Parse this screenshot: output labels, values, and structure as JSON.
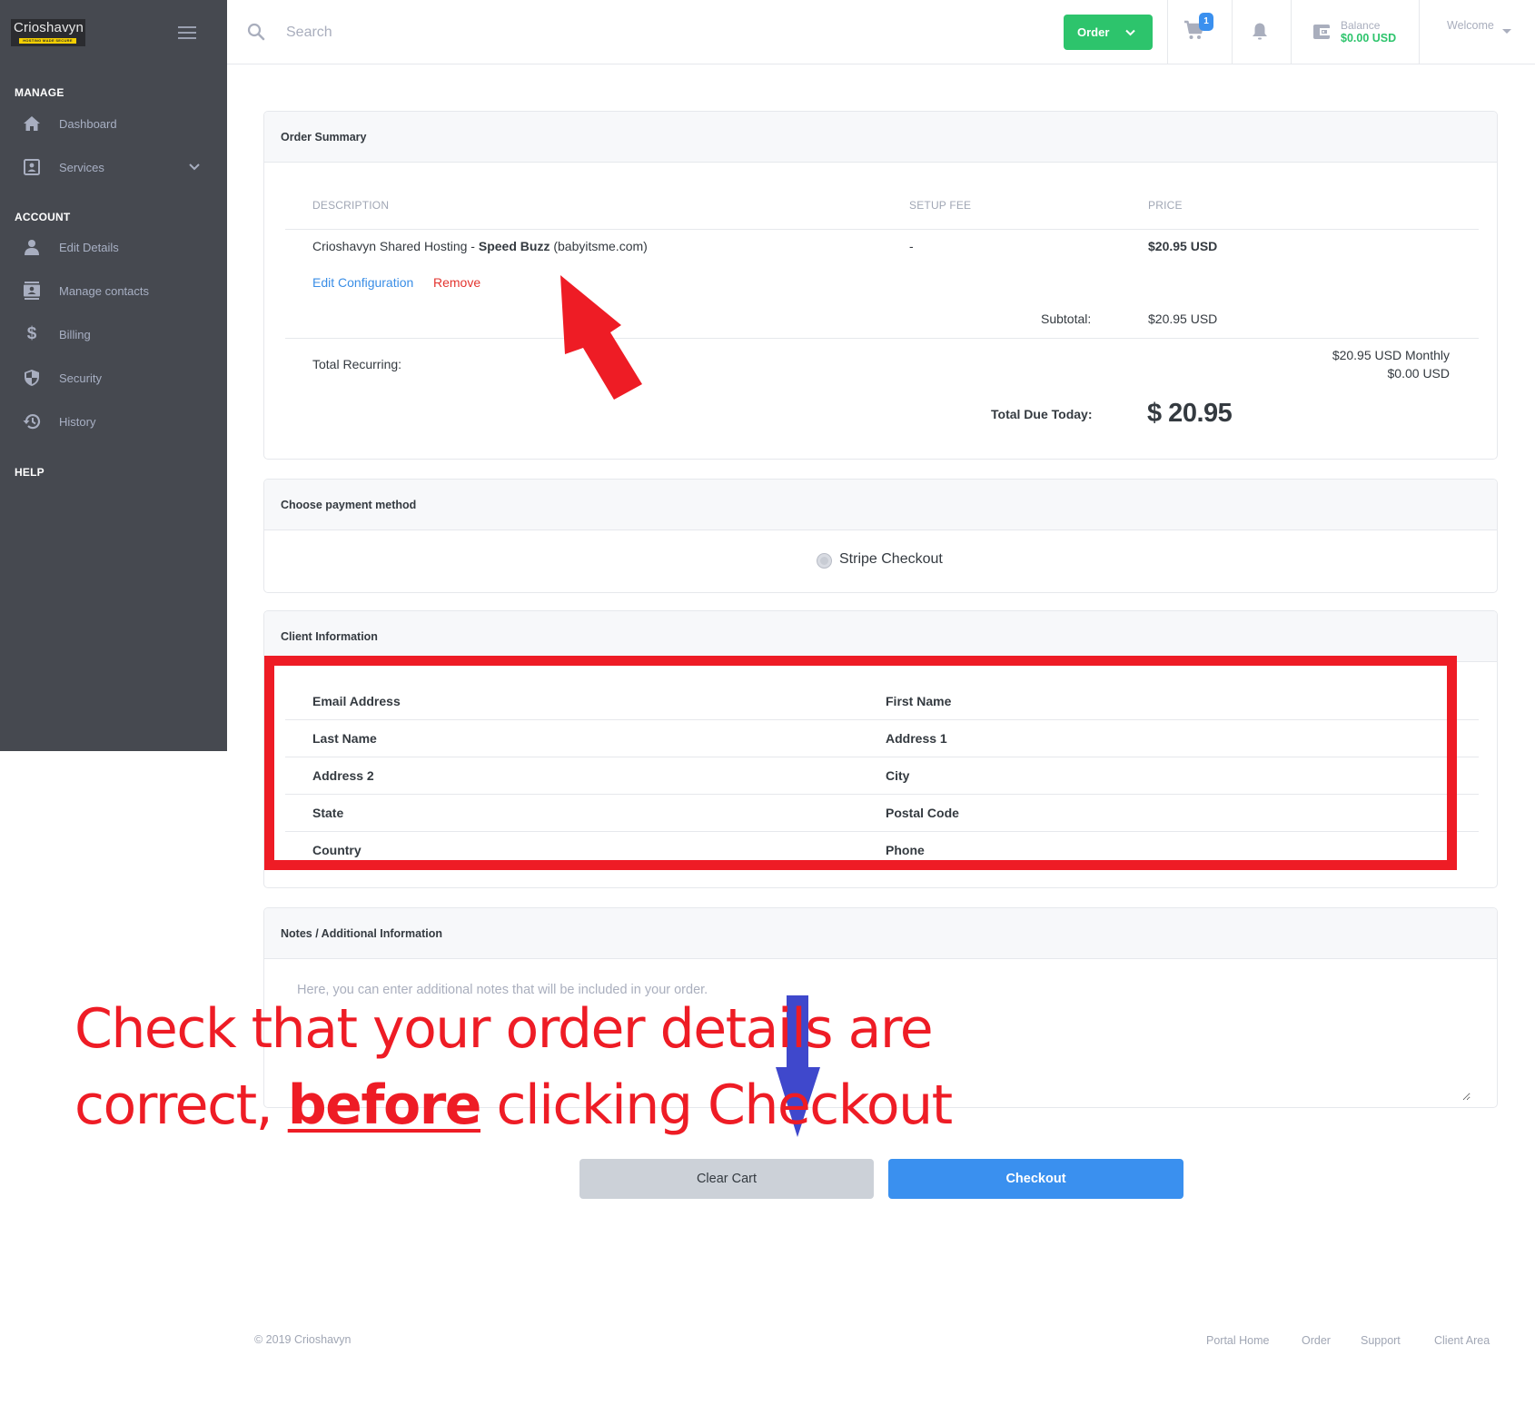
{
  "brand": {
    "name": "Crioshavyn",
    "tagline": "HOSTING MADE SECURE"
  },
  "sidebar": {
    "sections": {
      "manage": "MANAGE",
      "account": "ACCOUNT",
      "help": "HELP"
    },
    "items": [
      {
        "label": "Dashboard",
        "icon": "home-icon"
      },
      {
        "label": "Services",
        "icon": "id-card-icon",
        "has_dropdown": true
      },
      {
        "label": "Edit Details",
        "icon": "user-icon"
      },
      {
        "label": "Manage contacts",
        "icon": "contacts-icon"
      },
      {
        "label": "Billing",
        "icon": "dollar-icon"
      },
      {
        "label": "Security",
        "icon": "shield-icon"
      },
      {
        "label": "History",
        "icon": "history-icon"
      }
    ]
  },
  "header": {
    "search_placeholder": "Search",
    "order_button": "Order",
    "cart_count": "1",
    "balance_label": "Balance",
    "balance_value": "$0.00 USD",
    "welcome": "Welcome"
  },
  "order_summary": {
    "title": "Order Summary",
    "columns": [
      "DESCRIPTION",
      "SETUP FEE",
      "PRICE"
    ],
    "item": {
      "product": "Crioshavyn Shared Hosting - ",
      "plan": "Speed Buzz",
      "domain": " (babyitsme.com)",
      "setup_fee": "-",
      "price": "$20.95 USD"
    },
    "edit_link": "Edit Configuration",
    "remove_link": "Remove",
    "subtotal_label": "Subtotal:",
    "subtotal_value": "$20.95 USD",
    "recurring_label": "Total Recurring:",
    "recurring_lines": [
      "$20.95 USD Monthly",
      "$0.00 USD"
    ],
    "due_label": "Total Due Today:",
    "due_value": "$ 20.95"
  },
  "payment": {
    "title": "Choose payment method",
    "option": "Stripe Checkout"
  },
  "client_info": {
    "title": "Client Information",
    "rows": [
      [
        "Email Address",
        "First Name"
      ],
      [
        "Last Name",
        "Address 1"
      ],
      [
        "Address 2",
        "City"
      ],
      [
        "State",
        "Postal Code"
      ],
      [
        "Country",
        "Phone"
      ]
    ]
  },
  "notes": {
    "title": "Notes / Additional Information",
    "placeholder": "Here, you can enter additional notes that will be included in your order."
  },
  "actions": {
    "clear_cart": "Clear Cart",
    "checkout": "Checkout"
  },
  "footer": {
    "copyright": "© 2019 Crioshavyn",
    "links": [
      "Portal Home",
      "Order",
      "Support",
      "Client Area"
    ]
  },
  "annotation": {
    "line1": "Check that your order details are",
    "line2_pre": "correct, ",
    "line2_emph": "before",
    "line2_post": " clicking Checkout",
    "colors": {
      "red": "#ee1c25",
      "blue": "#3f48cc"
    }
  }
}
